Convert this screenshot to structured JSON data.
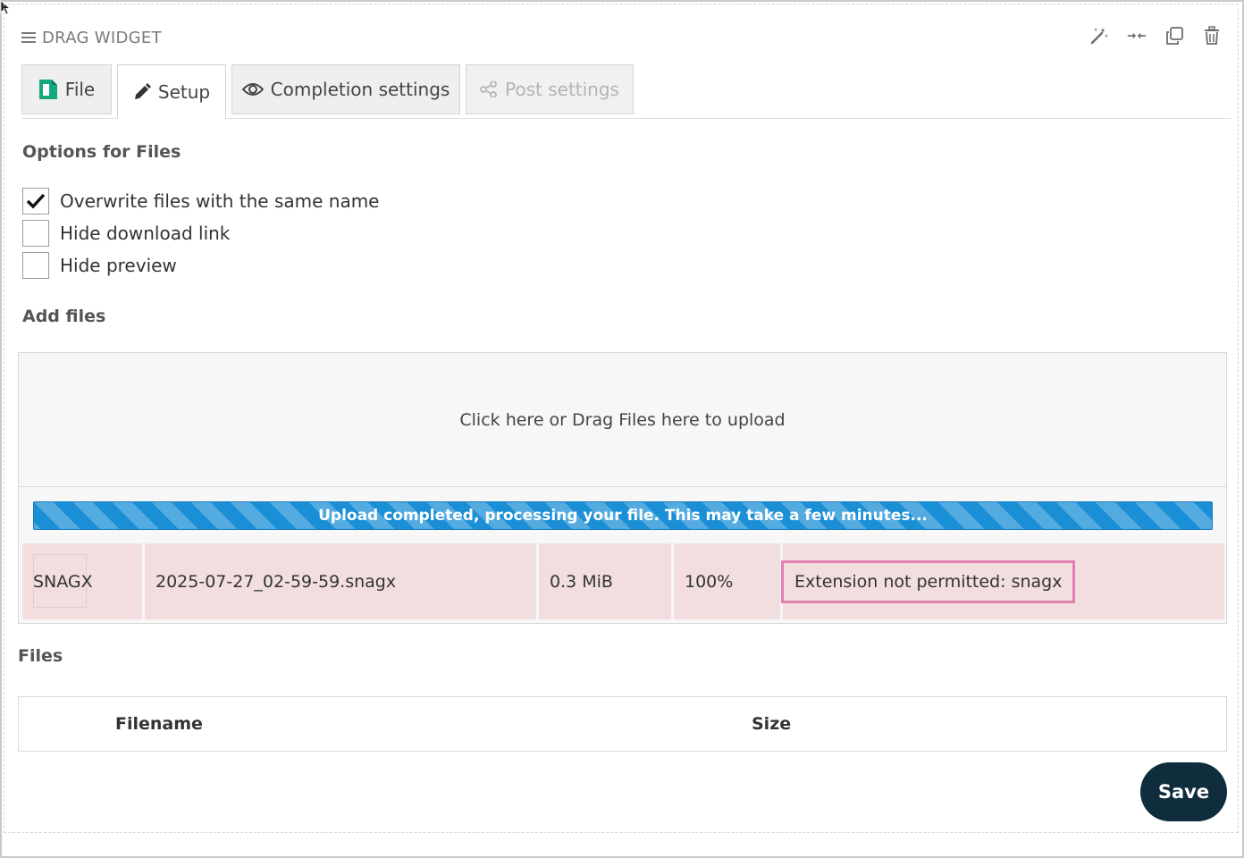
{
  "widget": {
    "title": "DRAG WIDGET"
  },
  "toolbar": {
    "icons": [
      "magic-wand-icon",
      "collapse-arrows-icon",
      "duplicate-icon",
      "trash-icon"
    ]
  },
  "tabs": [
    {
      "label": "File",
      "state": "normal"
    },
    {
      "label": "Setup",
      "state": "active"
    },
    {
      "label": "Completion settings",
      "state": "normal"
    },
    {
      "label": "Post settings",
      "state": "disabled"
    }
  ],
  "options": {
    "heading": "Options for Files",
    "items": [
      {
        "label": "Overwrite files with the same name",
        "checked": true
      },
      {
        "label": "Hide download link",
        "checked": false
      },
      {
        "label": "Hide preview",
        "checked": false
      }
    ]
  },
  "add_files": {
    "heading": "Add files",
    "drop_text": "Click here or Drag Files here to upload",
    "progress_text": "Upload completed, processing your file. This may take a few minutes...",
    "file": {
      "thumbnail_text": "SNAGX",
      "name": "2025-07-27_02-59-59.snagx",
      "size": "0.3 MiB",
      "progress": "100%",
      "error": "Extension not permitted: snagx"
    }
  },
  "files": {
    "heading": "Files",
    "columns": [
      "Filename",
      "Size"
    ]
  },
  "save_label": "Save",
  "colors": {
    "progress_bar": "#1b8fd6",
    "error_row": "#f2dede",
    "error_highlight": "#e07fb0",
    "save_button": "#0f2d3d"
  }
}
